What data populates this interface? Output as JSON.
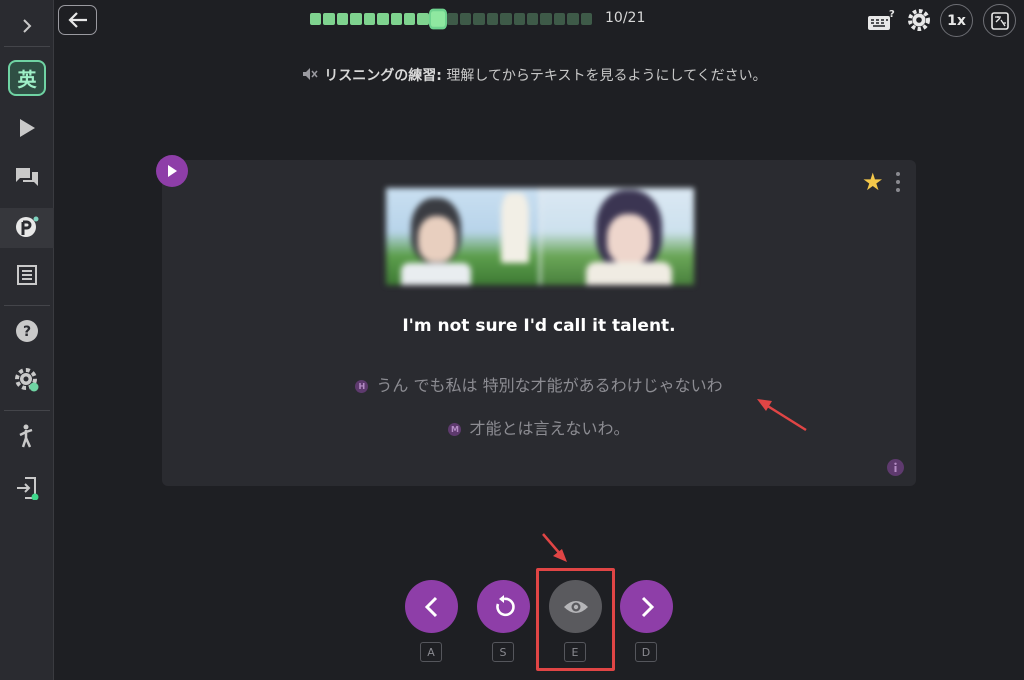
{
  "sidebar": {
    "expand_icon": "chevron-right-icon",
    "language_badge": "英",
    "items": [
      {
        "name": "play",
        "icon": "play-icon"
      },
      {
        "name": "chat",
        "icon": "chat-icon"
      },
      {
        "name": "p-mode",
        "icon": "p-pinwheel-icon"
      },
      {
        "name": "list",
        "icon": "list-icon"
      },
      {
        "name": "help",
        "icon": "help-icon"
      },
      {
        "name": "settings",
        "icon": "gear-icon"
      },
      {
        "name": "exercise",
        "icon": "person-icon"
      },
      {
        "name": "exit",
        "icon": "exit-icon"
      }
    ]
  },
  "topbar": {
    "progress_text": "10/21",
    "progress_current": 10,
    "progress_total": 21,
    "speed_label": "1x"
  },
  "instruction": {
    "label": "リスニングの練習:",
    "text": " 理解してからテキストを見るようにしてください。"
  },
  "card": {
    "sentence_en": "I'm not sure I'd call it talent.",
    "translation_h_marker": "H",
    "translation_h": "うん でも私は 特別な才能があるわけじゃないわ",
    "translation_m_marker": "M",
    "translation_m": "才能とは言えないわ。",
    "info_marker": "i"
  },
  "controls": {
    "prev_key": "A",
    "replay_key": "S",
    "reveal_key": "E",
    "next_key": "D"
  },
  "colors": {
    "accent_purple": "#8e3ea8",
    "progress_green": "#7fd38f",
    "annotation_red": "#e04545"
  }
}
